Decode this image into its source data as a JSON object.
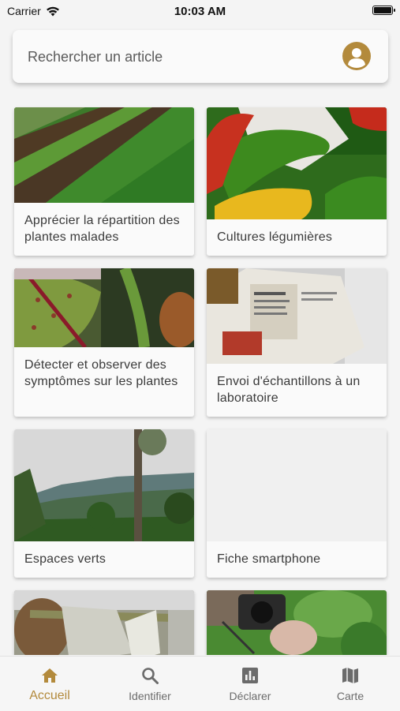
{
  "status_bar": {
    "carrier": "Carrier",
    "time": "10:03 AM"
  },
  "search": {
    "placeholder": "Rechercher un article",
    "icon": "account-icon"
  },
  "articles": [
    {
      "title": "Apprécier la répartition des plantes malades"
    },
    {
      "title": "Cultures légumières"
    },
    {
      "title": "Détecter et observer des symptômes sur les plantes"
    },
    {
      "title": "Envoi d'échantillons à un laboratoire"
    },
    {
      "title": "Espaces verts"
    },
    {
      "title": "Fiche smartphone"
    },
    {
      "title": ""
    },
    {
      "title": ""
    }
  ],
  "tabs": [
    {
      "label": "Accueil",
      "icon": "home-icon",
      "active": true
    },
    {
      "label": "Identifier",
      "icon": "search-icon",
      "active": false
    },
    {
      "label": "Déclarer",
      "icon": "chart-icon",
      "active": false
    },
    {
      "label": "Carte",
      "icon": "map-icon",
      "active": false
    }
  ],
  "colors": {
    "accent": "#b38a3c",
    "background": "#f4f4f4",
    "card": "#fafafa",
    "inactive_tab": "#6b6b6b"
  }
}
